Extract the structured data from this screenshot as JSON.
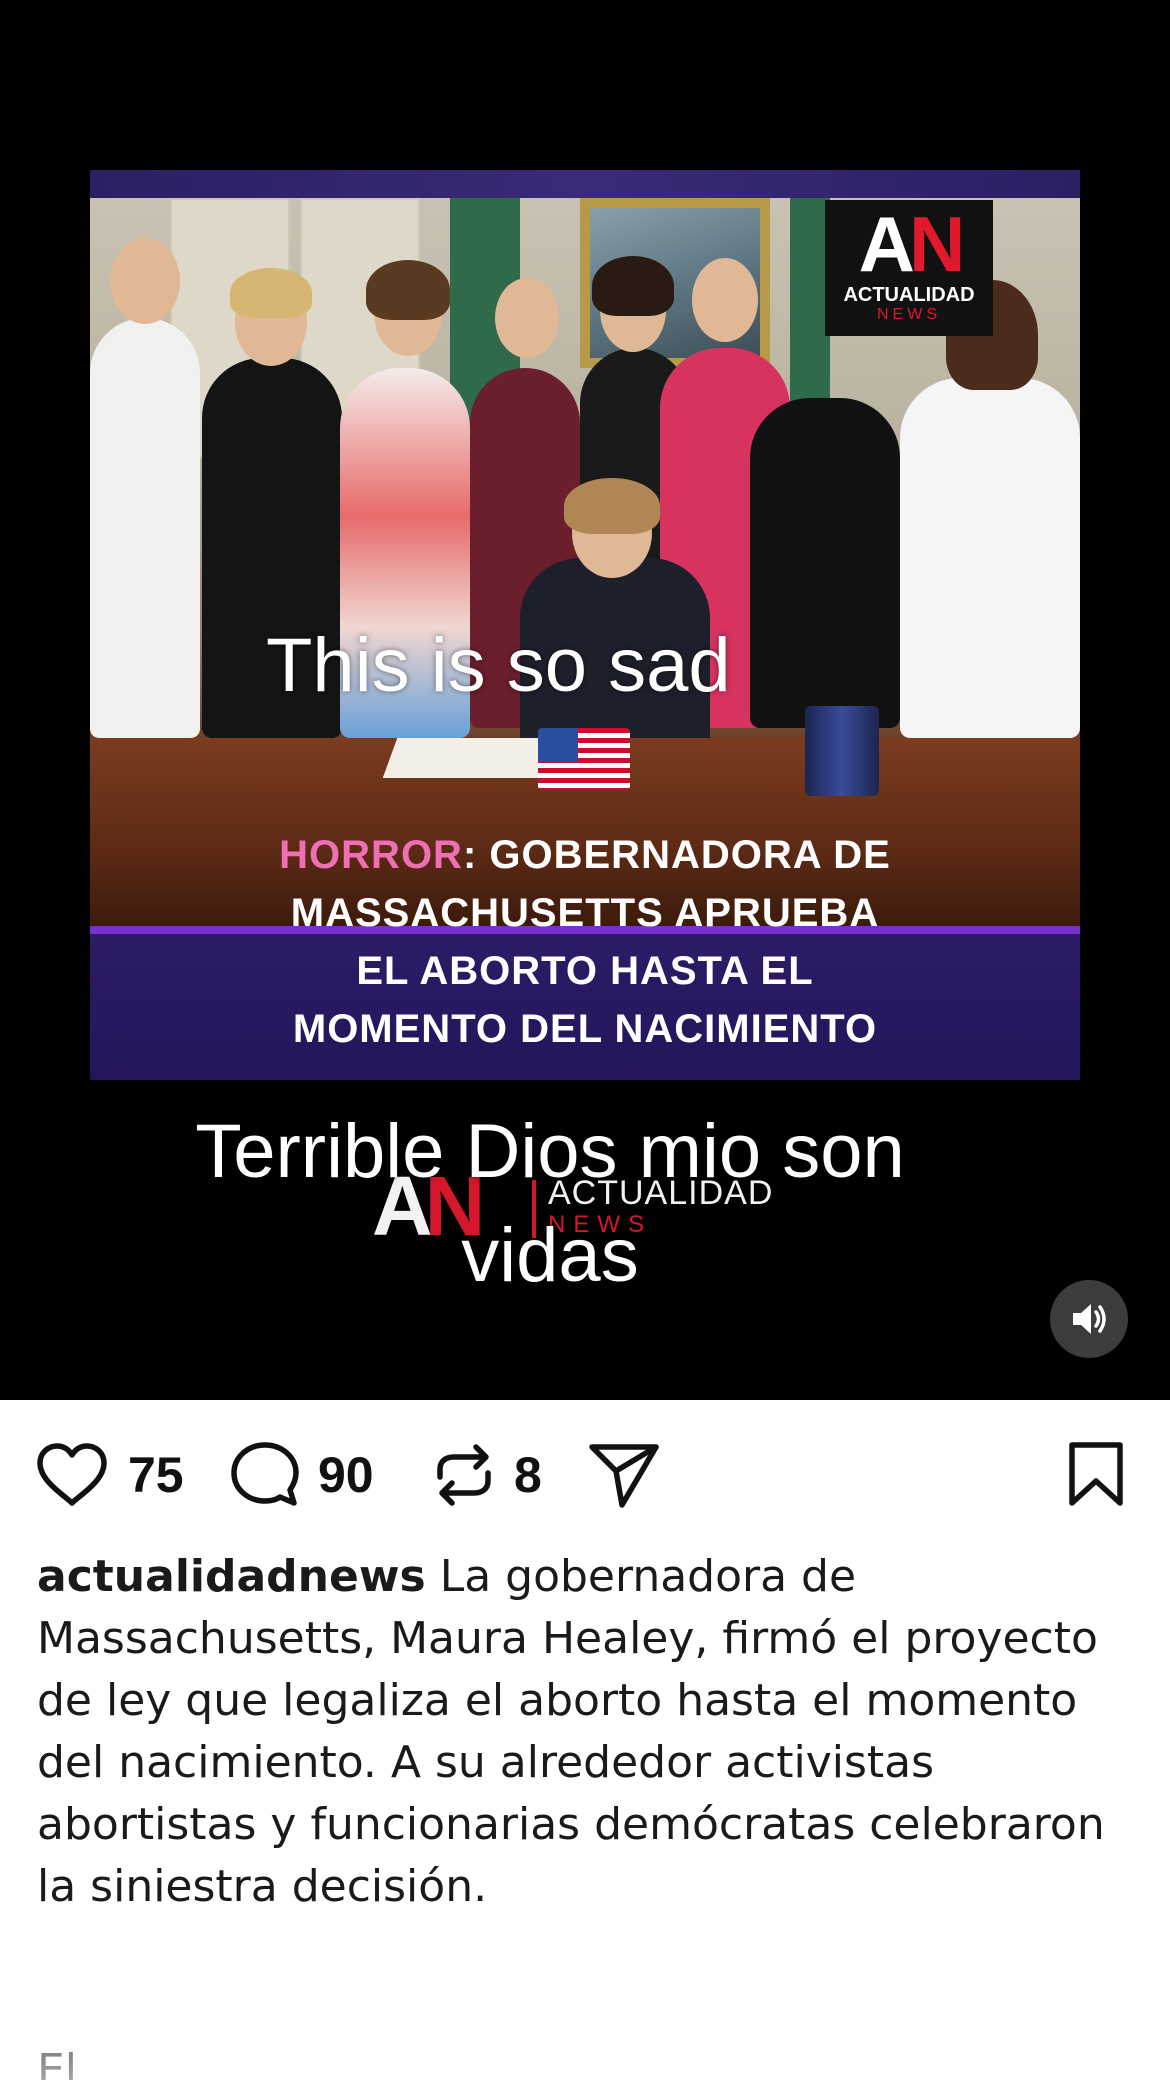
{
  "video": {
    "logo": {
      "letters_a": "A",
      "letters_n": "N",
      "line1": "ACTUALIDAD",
      "line2": "NEWS"
    },
    "headline": {
      "highlight": "HORROR",
      "rest_line1": ": GOBERNADORA DE",
      "line2": "MASSACHUSETTS APRUEBA",
      "line3": "EL ABORTO HASTA EL",
      "line4": "MOMENTO DEL NACIMIENTO"
    },
    "overlay_text_1": "This is so sad",
    "overlay_text_2_line1": "Terrible Dios mio son",
    "overlay_text_2_line2": "vidas",
    "watermark": {
      "letters_a": "A",
      "letters_n": "N",
      "line1": "ACTUALIDAD",
      "line2": "NEWS"
    },
    "sound_icon": "speaker-volume-icon"
  },
  "actions": {
    "like": {
      "icon": "heart-icon",
      "count": "75"
    },
    "comment": {
      "icon": "speech-bubble-icon",
      "count": "90"
    },
    "repost": {
      "icon": "repost-icon",
      "count": "8"
    },
    "share": {
      "icon": "paper-plane-icon"
    },
    "save": {
      "icon": "bookmark-icon"
    }
  },
  "caption": {
    "username": "actualidadnews",
    "text": "La gobernadora de Massachusetts, Maura Healey, firmó el proyecto de ley que legaliza el aborto hasta el momento del nacimiento. A su alrededor activistas abortistas y funcionarias demócratas celebraron la siniestra decisión.",
    "next_paragraph_partial": "El"
  },
  "colors": {
    "headline_band": "#2d1b66",
    "highlight_pink": "#ef6fb4",
    "logo_red": "#e0192d",
    "background_video": "#000000"
  }
}
